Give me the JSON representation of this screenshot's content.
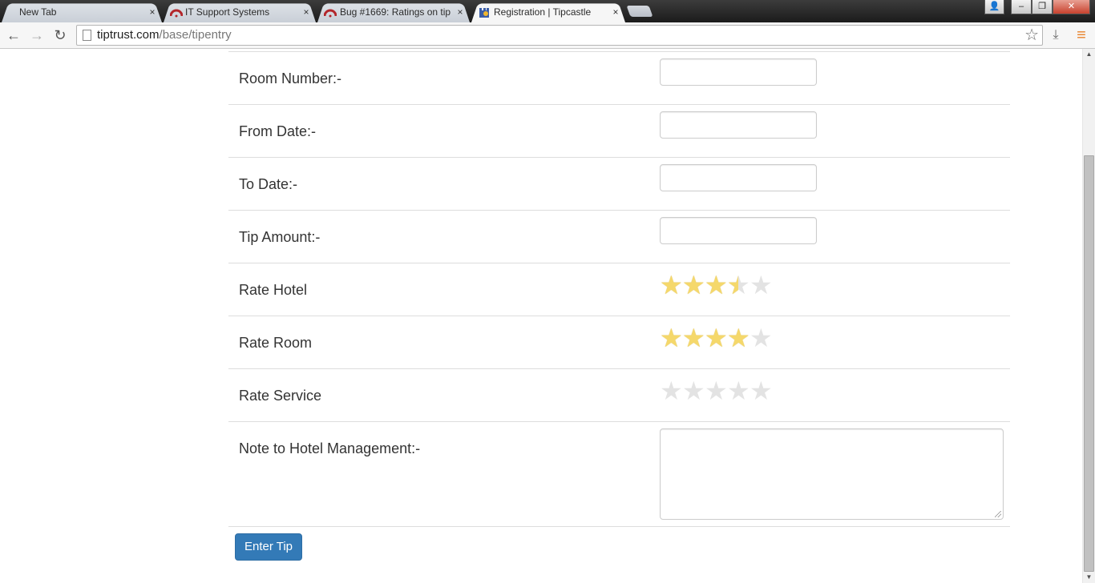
{
  "browser": {
    "tabs": [
      {
        "title": "New Tab",
        "icon": "blank-icon",
        "close": "×"
      },
      {
        "title": "IT Support Systems",
        "icon": "redmine-icon",
        "close": "×"
      },
      {
        "title": "Bug #1669: Ratings on tip",
        "icon": "redmine-icon",
        "close": "×"
      },
      {
        "title": "Registration | Tipcastle",
        "icon": "tipcastle-icon",
        "close": "×"
      }
    ],
    "url_host": "tiptrust.com",
    "url_path": "/base/tipentry",
    "window_buttons": {
      "profile": "👤",
      "minimize": "‒",
      "restore": "❐",
      "close": "✕"
    },
    "nav": {
      "back": "←",
      "forward": "→",
      "reload": "↻",
      "bookmark": "☆",
      "download": "⤓",
      "menu": "≡"
    }
  },
  "form": {
    "room_number_label": "Room Number:-",
    "from_date_label": "From Date:-",
    "to_date_label": "To Date:-",
    "tip_amount_label": "Tip Amount:-",
    "rate_hotel_label": "Rate Hotel",
    "rate_room_label": "Rate Room",
    "rate_service_label": "Rate Service",
    "note_label": "Note to Hotel Management:-",
    "room_number_value": "",
    "from_date_value": "",
    "to_date_value": "",
    "tip_amount_value": "",
    "note_value": "",
    "ratings": {
      "hotel": 3.5,
      "room": 4,
      "service": 0,
      "max": 5
    },
    "star_color": "#f5d86b",
    "star_empty_color": "#e3e3e3",
    "submit_label": "Enter Tip",
    "submit_color": "#337ab7"
  }
}
